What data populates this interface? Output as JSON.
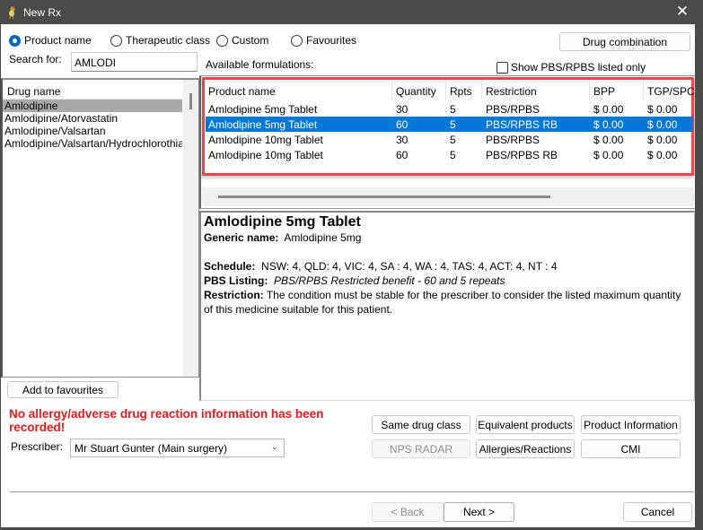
{
  "window": {
    "title": "New Rx",
    "app_icon": "bird-app-icon",
    "close_glyph": "✕"
  },
  "search_mode": {
    "options": [
      {
        "label": "Product name",
        "checked": true
      },
      {
        "label": "Therapeutic class",
        "checked": false
      },
      {
        "label": "Custom",
        "checked": false
      },
      {
        "label": "Favourites",
        "checked": false
      }
    ]
  },
  "search": {
    "label": "Search for:",
    "value": "AMLODI"
  },
  "toolbar": {
    "drug_combination": "Drug combination"
  },
  "formulations": {
    "label": "Available formulations:",
    "pbs_only_label": "Show PBS/RPBS listed only",
    "pbs_only_checked": false,
    "columns": [
      "Product name",
      "Quantity",
      "Rpts",
      "Restriction",
      "BPP",
      "TGP/SPC"
    ],
    "rows": [
      {
        "product": "Amlodipine  5mg Tablet",
        "quantity": "30",
        "rpts": "5",
        "restriction": "PBS/RPBS",
        "bpp": "$ 0.00",
        "tgp": "$ 0.00",
        "selected": false
      },
      {
        "product": "Amlodipine  5mg Tablet",
        "quantity": "60",
        "rpts": "5",
        "restriction": "PBS/RPBS RB",
        "bpp": "$ 0.00",
        "tgp": "$ 0.00",
        "selected": true
      },
      {
        "product": "Amlodipine  10mg Tablet",
        "quantity": "30",
        "rpts": "5",
        "restriction": "PBS/RPBS",
        "bpp": "$ 0.00",
        "tgp": "$ 0.00",
        "selected": false
      },
      {
        "product": "Amlodipine  10mg Tablet",
        "quantity": "60",
        "rpts": "5",
        "restriction": "PBS/RPBS RB",
        "bpp": "$ 0.00",
        "tgp": "$ 0.00",
        "selected": false
      }
    ]
  },
  "drug_list": {
    "header": "Drug name",
    "items": [
      {
        "label": "Amlodipine",
        "selected": true
      },
      {
        "label": "Amlodipine/Atorvastatin",
        "selected": false
      },
      {
        "label": "Amlodipine/Valsartan",
        "selected": false
      },
      {
        "label": "Amlodipine/Valsartan/Hydrochlorothiazide",
        "selected": false
      }
    ]
  },
  "detail": {
    "title": "Amlodipine  5mg Tablet",
    "generic_label": "Generic name:",
    "generic_value": "Amlodipine  5mg",
    "schedule_label": "Schedule:",
    "schedule_value": "NSW: 4,  QLD: 4,  VIC: 4,  SA : 4,  WA : 4,  TAS: 4,  ACT: 4,  NT : 4",
    "pbs_label": "PBS Listing:",
    "pbs_value": "PBS/RPBS Restricted benefit - 60 and 5 repeats",
    "restriction_label": "Restriction:",
    "restriction_value": "The condition must be stable for the prescriber to consider the listed maximum quantity of this medicine suitable for this patient."
  },
  "buttons": {
    "add_favourites": "Add to favourites",
    "same_drug_class": "Same drug class",
    "equivalent_products": "Equivalent products",
    "product_information": "Product Information",
    "nps_radar": "NPS RADAR",
    "allergies_reactions": "Allergies/Reactions",
    "cmi": "CMI",
    "back": "< Back",
    "next": "Next >",
    "cancel": "Cancel"
  },
  "warning": "No allergy/adverse drug reaction information has been recorded!",
  "prescriber": {
    "label": "Prescriber:",
    "value": "Mr Stuart Gunter (Main surgery)"
  },
  "colors": {
    "selection_blue": "#0078d7",
    "highlight_red": "#ee4449",
    "warning_red": "#e8191e",
    "titlebar": "#4a4a48"
  }
}
